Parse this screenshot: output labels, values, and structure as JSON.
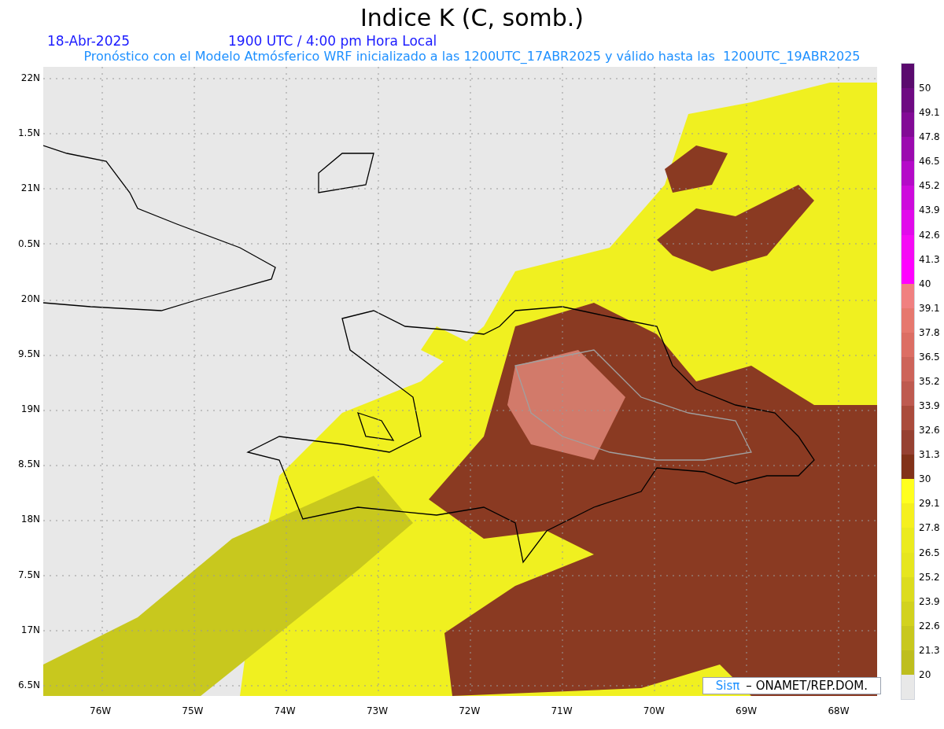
{
  "title": "Indice K (C, somb.)",
  "date": "18-Abr-2025",
  "time": "1900 UTC / 4:00 pm Hora Local",
  "subtitle": "Pronóstico con el Modelo Atmósferico WRF inicializado a las 1200UTC_17ABR2025 y válido hasta las  1200UTC_19ABR2025",
  "y_axis": [
    "22N",
    "1.5N",
    "21N",
    "0.5N",
    "20N",
    "9.5N",
    "19N",
    "8.5N",
    "18N",
    "7.5N",
    "17N",
    "6.5N"
  ],
  "x_axis": [
    "76W",
    "75W",
    "74W",
    "73W",
    "72W",
    "71W",
    "70W",
    "69W",
    "68W"
  ],
  "logo": {
    "brand": "Sisπ",
    "credit": "– ONAMET/REP.DOM."
  },
  "legend": [
    {
      "color": "#5a0a6e",
      "label": "50"
    },
    {
      "color": "#6e0a82",
      "label": "49.1"
    },
    {
      "color": "#820a96",
      "label": "47.8"
    },
    {
      "color": "#9b0aaf",
      "label": "46.5"
    },
    {
      "color": "#b40ac8",
      "label": "45.2"
    },
    {
      "color": "#cd0adc",
      "label": "43.9"
    },
    {
      "color": "#e10aeb",
      "label": "42.6"
    },
    {
      "color": "#f50af5",
      "label": "41.3"
    },
    {
      "color": "#ff00ff",
      "label": "40"
    },
    {
      "color": "#f08080",
      "label": "39.1"
    },
    {
      "color": "#e6786e",
      "label": "37.8"
    },
    {
      "color": "#dc6e64",
      "label": "36.5"
    },
    {
      "color": "#cd645a",
      "label": "35.2"
    },
    {
      "color": "#be5a50",
      "label": "33.9"
    },
    {
      "color": "#aa4b3c",
      "label": "32.6"
    },
    {
      "color": "#964132",
      "label": "31.3"
    },
    {
      "color": "#823219",
      "label": "30"
    },
    {
      "color": "#ffff1e",
      "label": "29.1"
    },
    {
      "color": "#f5f01e",
      "label": "27.8"
    },
    {
      "color": "#ebeb1e",
      "label": "26.5"
    },
    {
      "color": "#e6e61e",
      "label": "25.2"
    },
    {
      "color": "#dcdc1e",
      "label": "23.9"
    },
    {
      "color": "#d2d21e",
      "label": "22.6"
    },
    {
      "color": "#c8c81e",
      "label": "21.3"
    },
    {
      "color": "#bebe1e",
      "label": "20"
    },
    {
      "color": "#e8e8e8"
    }
  ]
}
